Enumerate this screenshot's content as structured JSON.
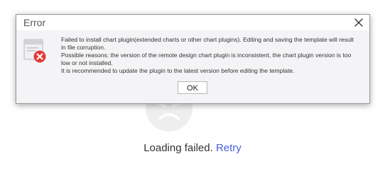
{
  "page": {
    "loading_text": "Loading failed.",
    "retry_link": "Retry"
  },
  "dialog": {
    "title": "Error",
    "message_lines": [
      "Failed to install chart plugin(extended charts or other chart plugins). Editing and saving the template will result in file corruption.",
      "Possible reasons: the version of the remote design chart plugin is inconsistent, the chart plugin version is too low or not installed.",
      "It is recommended to update the plugin to the latest version before editing the template."
    ],
    "ok_label": "OK"
  },
  "colors": {
    "error_red": "#e23b3b",
    "link_blue": "#4a5fd9",
    "dialog_bg": "#f4f4f6"
  },
  "icons": {
    "close": "close-icon",
    "error": "error-document-icon",
    "sad_face": "sad-face-icon"
  }
}
